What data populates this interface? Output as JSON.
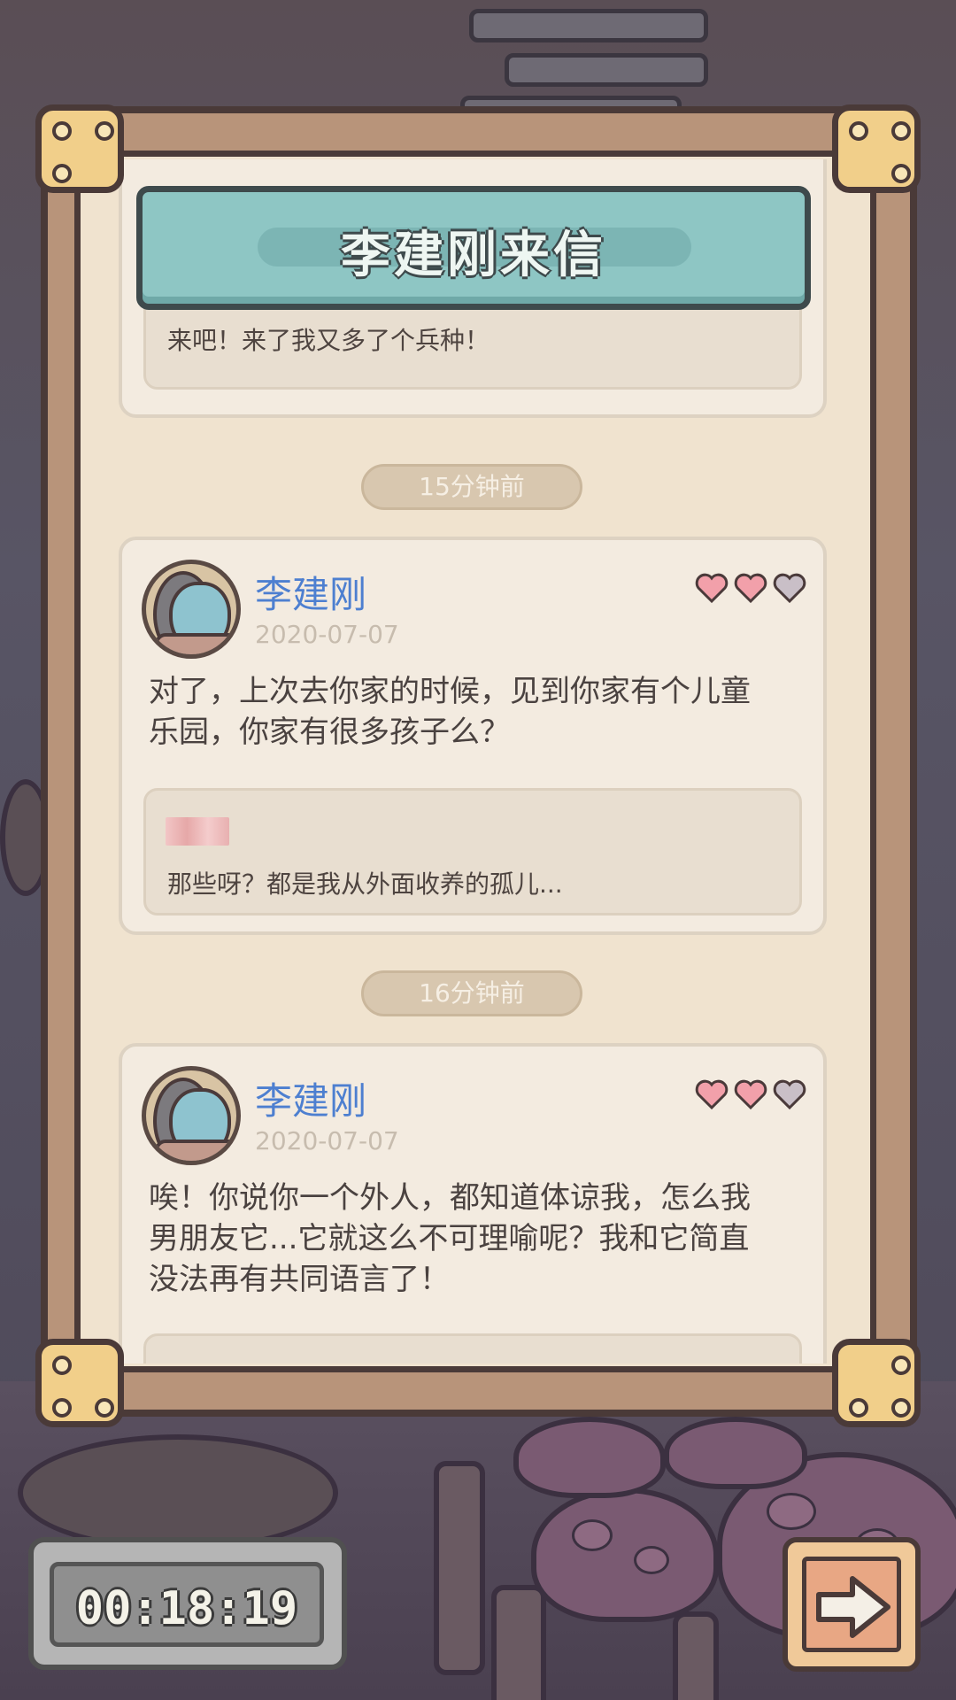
{
  "title": "李建刚来信",
  "previous_reply": {
    "text": "来吧！来了我又多了个兵种！"
  },
  "letters": [
    {
      "time_ago": "15分钟前",
      "sender": "李建刚",
      "date": "2020-07-07",
      "hearts_filled": 2,
      "hearts_total": 3,
      "message_line1": "对了，上次去你家的时候，见到你家有个儿童",
      "message_line2": "乐园，你家有很多孩子么？",
      "reply": "那些呀？都是我从外面收养的孤儿..."
    },
    {
      "time_ago": "16分钟前",
      "sender": "李建刚",
      "date": "2020-07-07",
      "hearts_filled": 2,
      "hearts_total": 3,
      "message_line1": "唉！你说你一个外人，都知道体谅我，怎么我",
      "message_line2": "男朋友它...它就这么不可理喻呢？我和它简直",
      "message_line3": "没法再有共同语言了！"
    }
  ],
  "timer": "00:18:19",
  "icons": {
    "next": "right-arrow-icon",
    "heart": "heart-icon"
  },
  "colors": {
    "sender": "#4d7fd0",
    "heart_filled": "#f2a0aa",
    "heart_empty": "#c9bfc7",
    "banner": "#8ec6c4"
  }
}
